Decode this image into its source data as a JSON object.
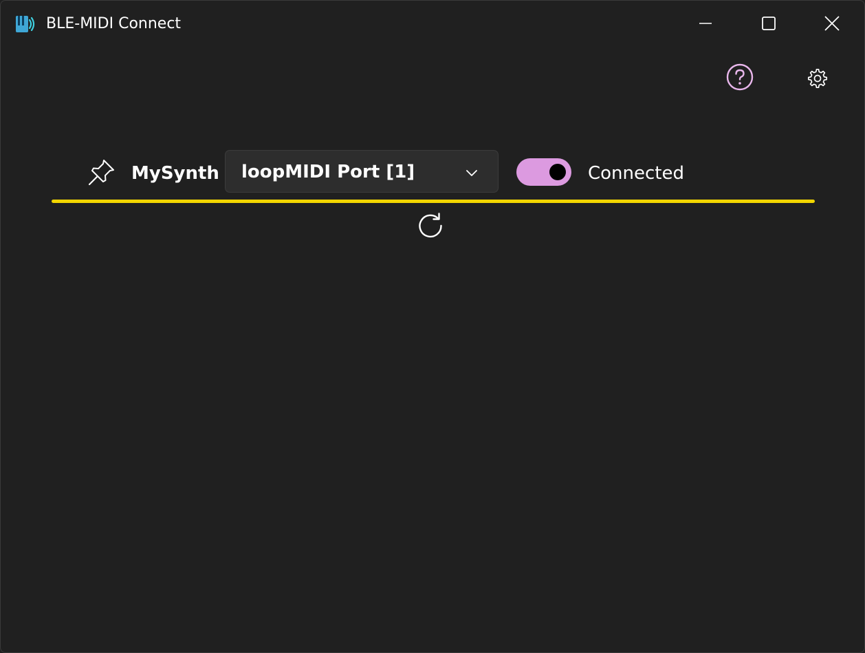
{
  "window": {
    "title": "BLE-MIDI Connect",
    "icon": "app-logo-icon",
    "controls": [
      "minimize-icon",
      "maximize-icon",
      "close-icon"
    ]
  },
  "toolbar": {
    "help_icon": "help-circle-icon",
    "settings_icon": "gear-icon"
  },
  "device": {
    "pin_icon": "pin-icon",
    "name": "MySynth",
    "port_selected": "loopMIDI Port [1]",
    "connected": true,
    "status": "Connected"
  },
  "refresh_icon": "refresh-icon",
  "colors": {
    "background": "#202020",
    "accent": "#dc9ae0",
    "divider": "#f2d600",
    "icon_accent": "#e9b7ec"
  }
}
